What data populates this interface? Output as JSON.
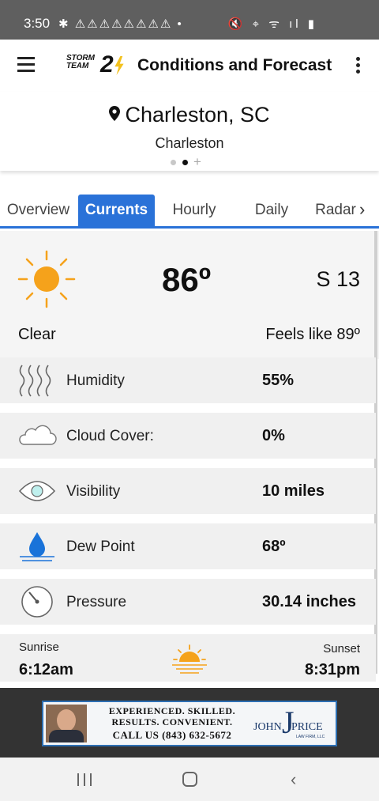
{
  "status_bar": {
    "time": "3:50",
    "notifications": "✱ ⚠⚠⚠⚠⚠⚠⚠⚠ •",
    "system_icons": "🔇 ⌖ ᯤ ıl ▮"
  },
  "app_bar": {
    "title": "Conditions and Forecast",
    "logo_text_top": "STORM",
    "logo_text_bottom": "TEAM",
    "logo_number": "2"
  },
  "location": {
    "city": "Charleston, SC",
    "subtitle": "Charleston",
    "add_symbol": "+"
  },
  "tabs": [
    {
      "label": "Overview"
    },
    {
      "label": "Currents"
    },
    {
      "label": "Hourly"
    },
    {
      "label": "Daily"
    },
    {
      "label": "Radar"
    }
  ],
  "current": {
    "temperature": "86º",
    "wind": "S 13",
    "condition": "Clear",
    "feels_like": "Feels like 89º"
  },
  "details": [
    {
      "label": "Humidity",
      "value": "55%",
      "icon": "humidity-icon"
    },
    {
      "label": "Cloud Cover:",
      "value": "0%",
      "icon": "cloud-icon"
    },
    {
      "label": "Visibility",
      "value": "10 miles",
      "icon": "eye-icon"
    },
    {
      "label": "Dew Point",
      "value": "68º",
      "icon": "droplet-icon"
    },
    {
      "label": "Pressure",
      "value": "30.14 inches",
      "icon": "gauge-icon"
    }
  ],
  "sun": {
    "sunrise_label": "Sunrise",
    "sunrise_time": "6:12am",
    "sunset_label": "Sunset",
    "sunset_time": "8:31pm"
  },
  "ad": {
    "line1": "EXPERIENCED. SKILLED.",
    "line2": "RESULTS. CONVENIENT.",
    "line3": "CALL US (843) 632-5672",
    "brand_first": "JOHN",
    "brand_initial": "J",
    "brand_last": "PRICE",
    "brand_tagline": "LAW FIRM, LLC"
  },
  "colors": {
    "accent": "#2a72d8",
    "sun": "#f5a21b",
    "status_bar": "#5f5f5f"
  }
}
